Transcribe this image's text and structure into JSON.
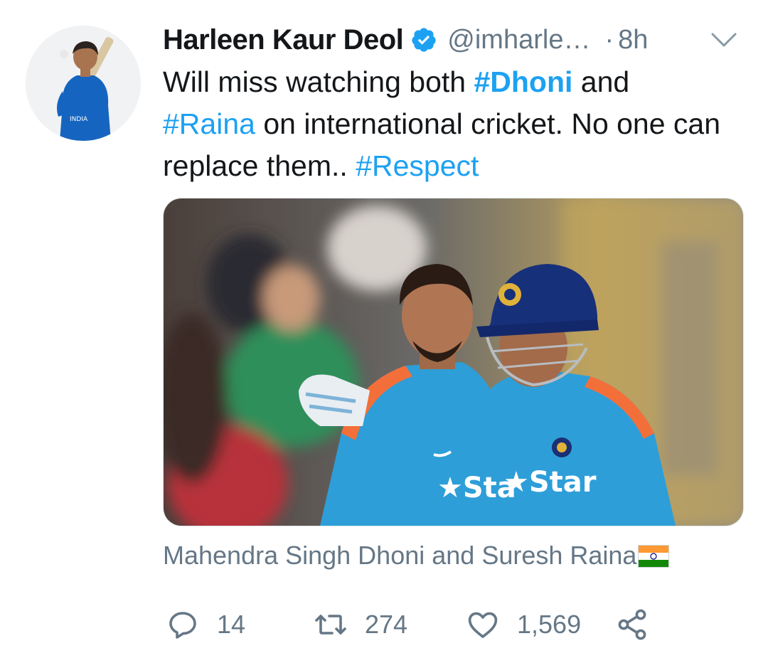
{
  "author": {
    "name": "Harleen Kaur Deol",
    "handle": "@imharle…",
    "separator": "·",
    "time": "8h"
  },
  "tweet": {
    "text_1": "Will miss watching both ",
    "tag_dhoni": "#Dhoni",
    "text_2": " and",
    "tag_raina": "#Raina",
    "text_3": " on international cricket. No one can replace them.. ",
    "tag_respect": "#Respect"
  },
  "media": {
    "caption": "Mahendra Singh Dhoni and Suresh Raina",
    "jersey_text_left": "★Sta",
    "jersey_text_right": "★Star"
  },
  "actions": {
    "replies": "14",
    "retweets": "274",
    "likes": "1,569"
  },
  "colors": {
    "accent": "#1da1f2",
    "text": "#14171a",
    "muted": "#657786"
  },
  "icons": [
    "verified-badge-icon",
    "chevron-down-icon",
    "reply-icon",
    "retweet-icon",
    "like-icon",
    "share-icon",
    "india-flag-icon"
  ]
}
